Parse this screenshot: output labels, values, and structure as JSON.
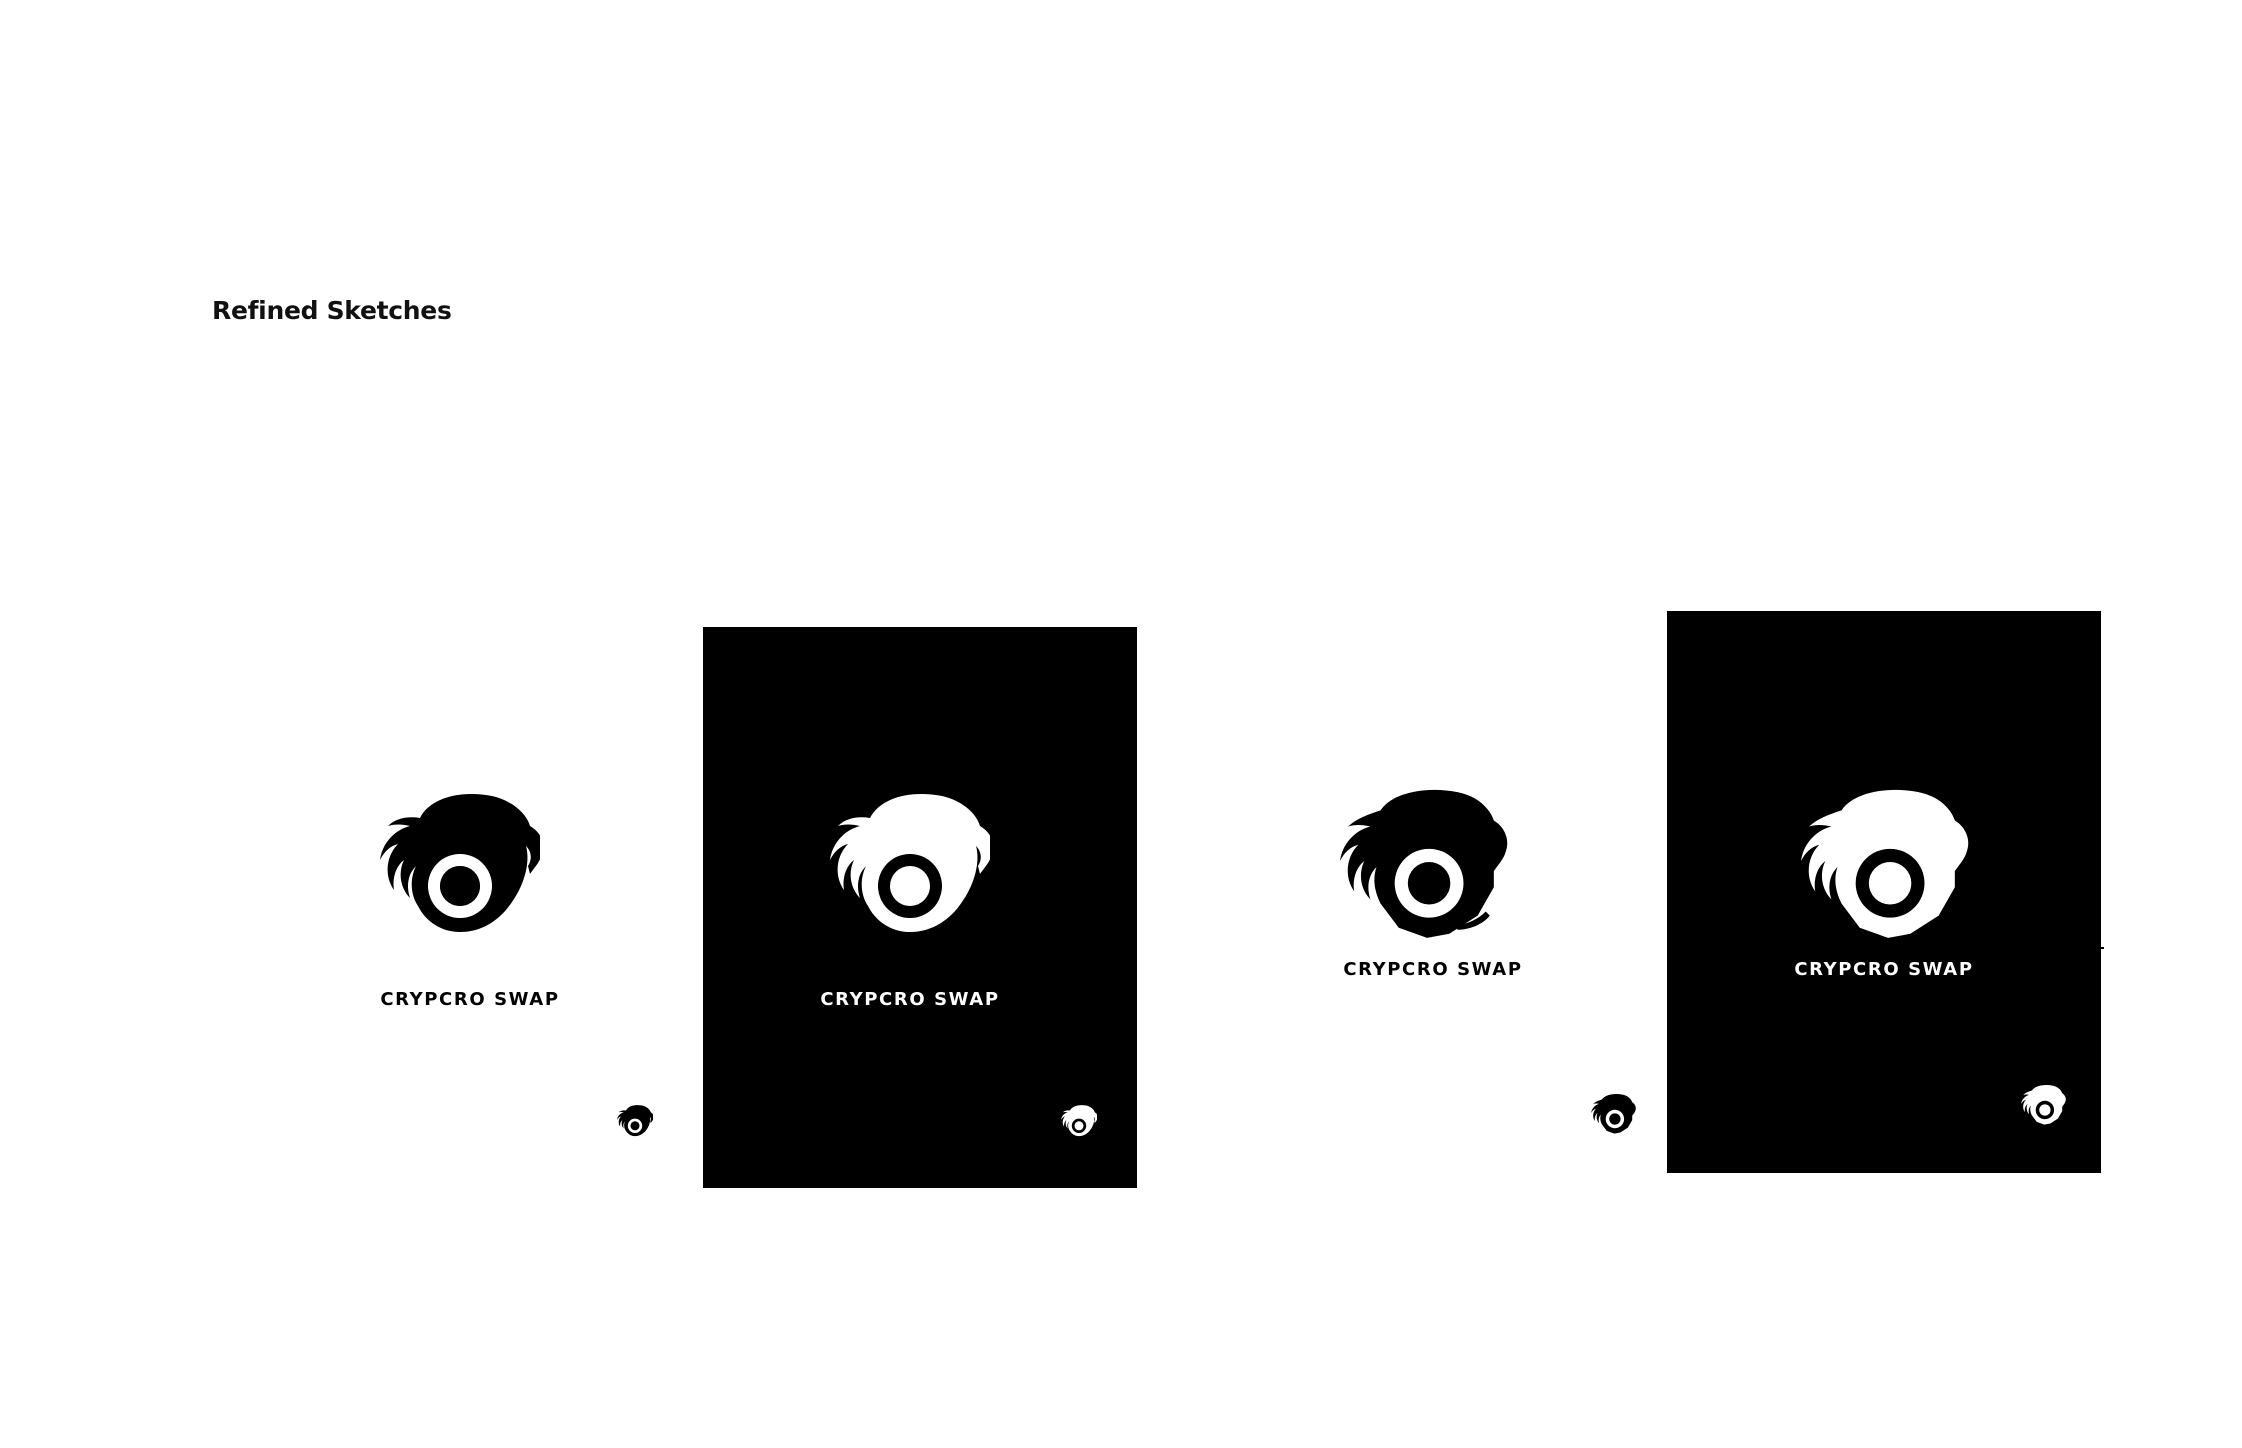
{
  "section_title": "Refined Sketches",
  "colors": {
    "background": "#ffffff",
    "ink": "#000000",
    "paper": "#ffffff"
  },
  "sketches": [
    {
      "variant": "round-eagle",
      "theme": "light",
      "wordmark": "CRYPCRO SWAP",
      "icon": "eagle-coin-icon"
    },
    {
      "variant": "round-eagle",
      "theme": "dark",
      "wordmark": "CRYPCRO SWAP",
      "icon": "eagle-coin-icon"
    },
    {
      "variant": "shield-eagle",
      "theme": "light",
      "wordmark": "CRYPCRO SWAP",
      "icon": "eagle-shield-icon"
    },
    {
      "variant": "shield-eagle",
      "theme": "dark",
      "wordmark": "CRYPCRO SWAP",
      "icon": "eagle-shield-icon"
    }
  ]
}
